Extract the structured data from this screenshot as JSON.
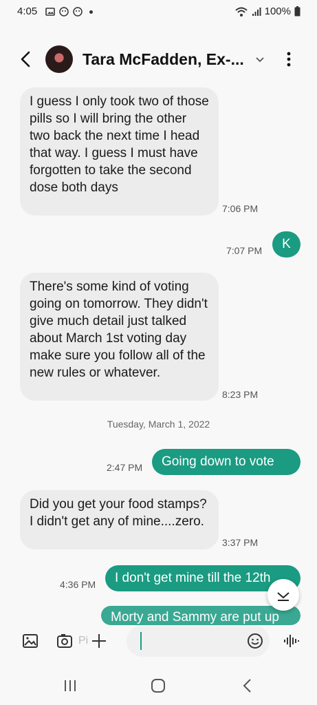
{
  "status_bar": {
    "time": "4:05",
    "battery": "100%"
  },
  "header": {
    "contact_name": "Tara McFadden, Ex-..."
  },
  "messages": [
    {
      "dir": "in",
      "text": "I guess I only took two of those pills so I will bring the other two back the next time I head that way. I guess I must have forgotten to take the second dose both days",
      "time": "7:06 PM"
    },
    {
      "dir": "out",
      "text": "K",
      "time": "7:07 PM"
    },
    {
      "dir": "in",
      "text": "There's some kind of voting going on tomorrow. They didn't give much detail just talked about March 1st voting day make sure you follow all of the new rules or whatever.",
      "time": "8:23 PM"
    },
    {
      "dir": "out",
      "text": "Going down to vote",
      "time": "2:47 PM"
    },
    {
      "dir": "in",
      "text": "Did you get your food stamps? I didn't get any of mine....zero.",
      "time": "3:37 PM"
    },
    {
      "dir": "out",
      "text": "I don't get mine till the 12th",
      "time": "4:36 PM"
    },
    {
      "dir": "out",
      "text": "Morty and Sammy are put up"
    }
  ],
  "date_separator": "Tuesday, March 1, 2022",
  "compose": {
    "value": "",
    "ghost": "Pi"
  }
}
